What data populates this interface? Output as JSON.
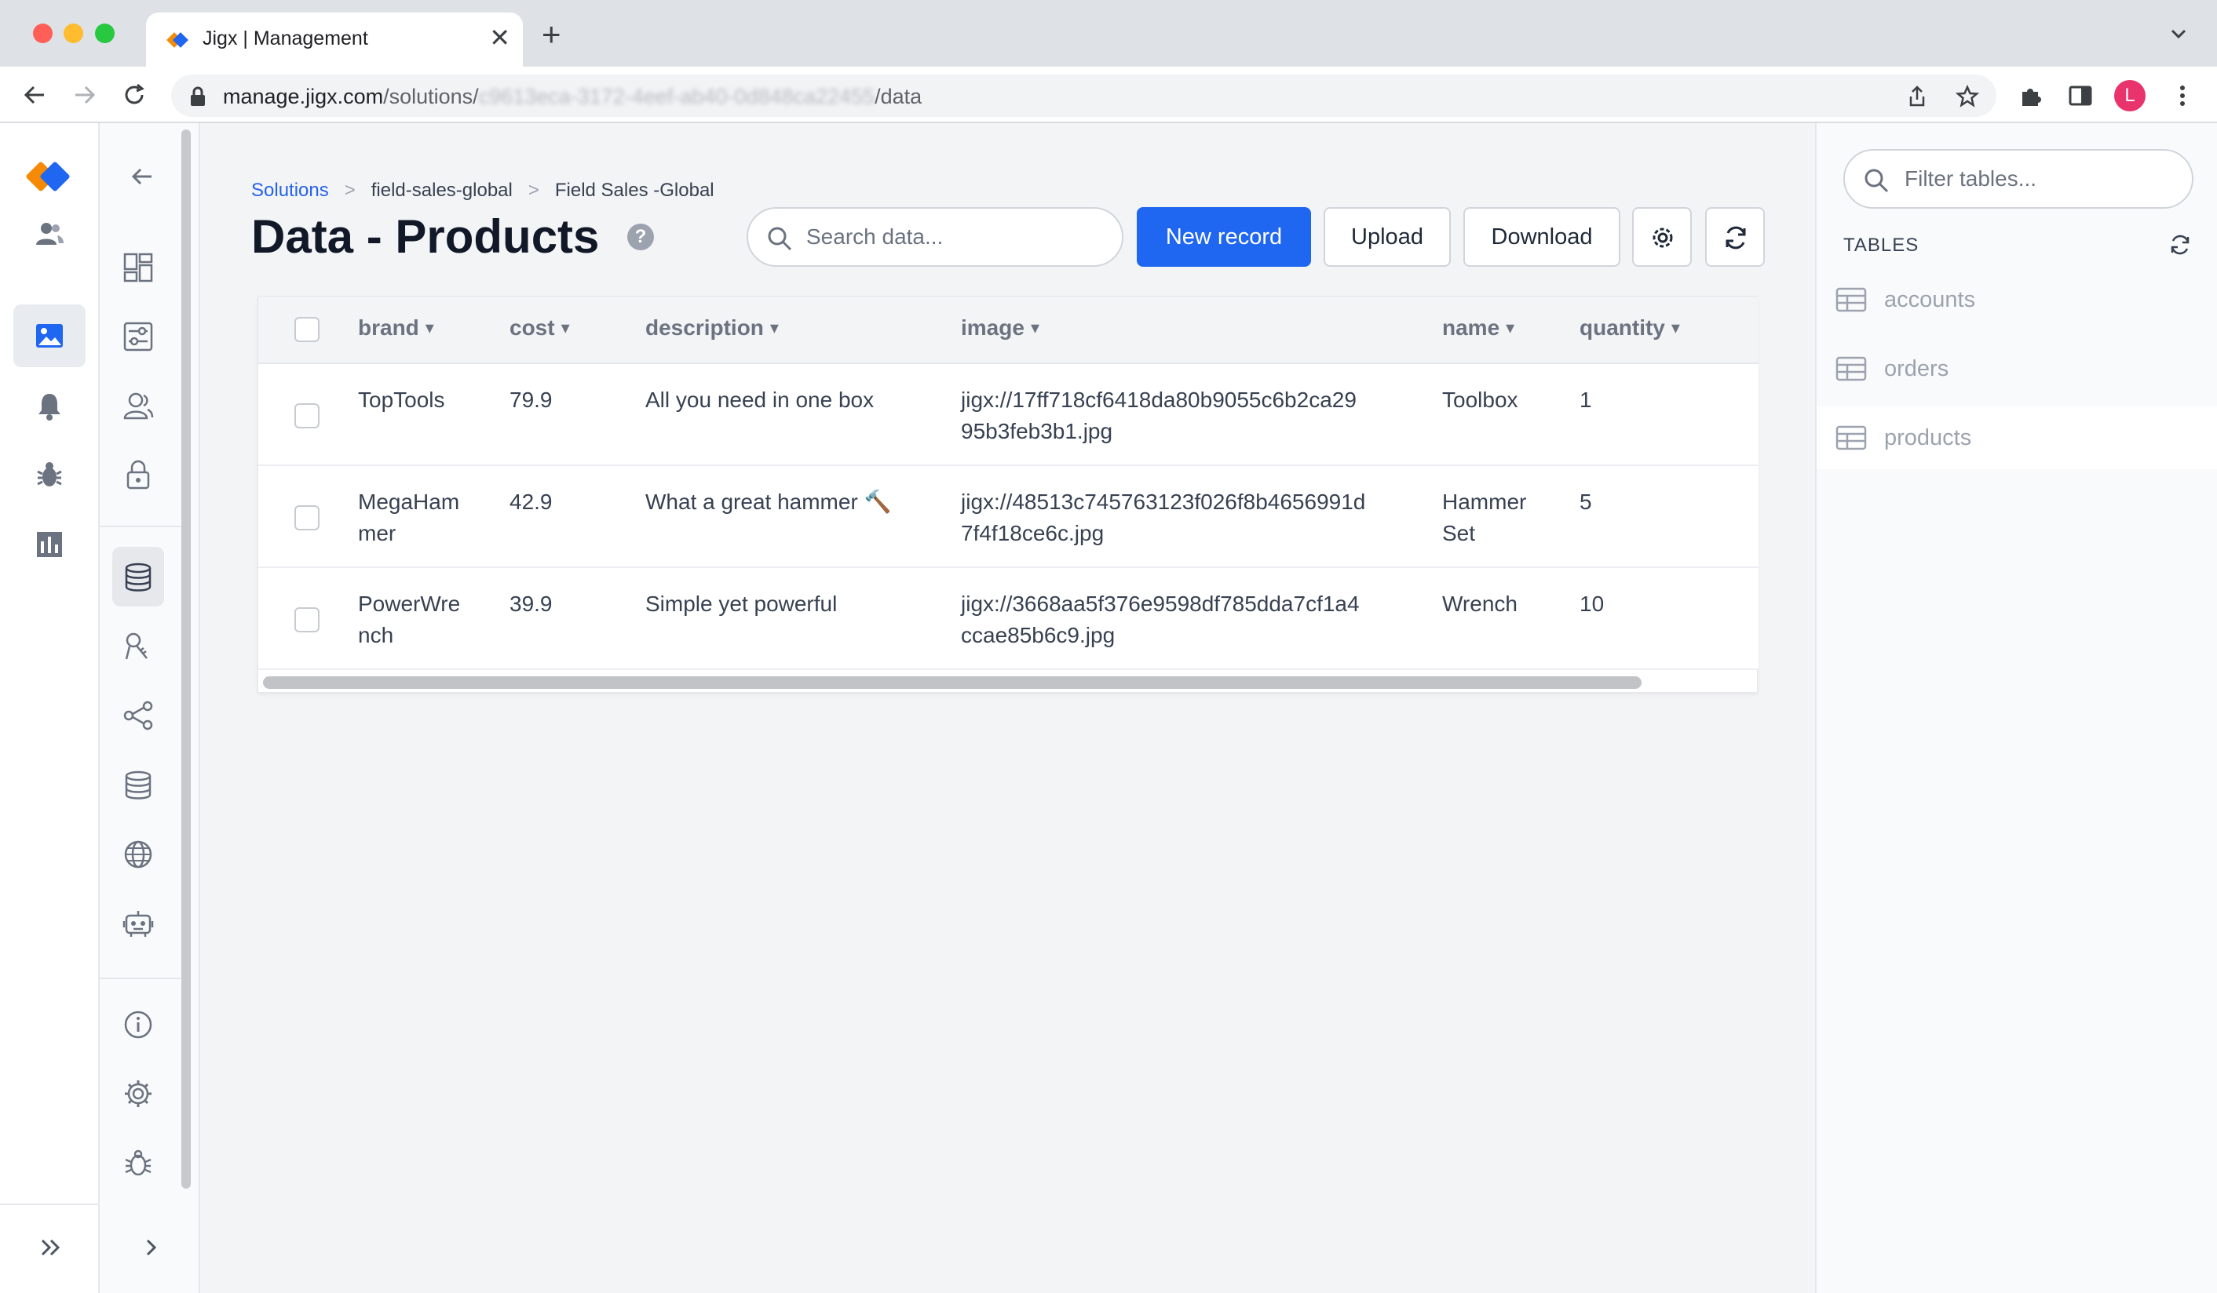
{
  "browser": {
    "tab_title": "Jigx | Management",
    "url_host": "manage.jigx.com",
    "url_path_1": "/solutions/",
    "url_blurred": "c9613eca-3172-4eef-ab40-0d848ca22455",
    "url_path_2": "/data",
    "profile_initial": "L"
  },
  "breadcrumb": {
    "items": [
      "Solutions",
      "field-sales-global",
      "Field Sales -Global"
    ],
    "separator": ">"
  },
  "page": {
    "title": "Data - Products",
    "help_glyph": "?"
  },
  "search": {
    "placeholder": "Search data..."
  },
  "actions": {
    "new_record": "New record",
    "upload": "Upload",
    "download": "Download"
  },
  "table": {
    "columns": [
      "brand",
      "cost",
      "description",
      "image",
      "name",
      "quantity"
    ],
    "rows": [
      {
        "brand": [
          "TopTools"
        ],
        "cost": "79.9",
        "description": "All you need in one box",
        "image": [
          "jigx://17ff718cf6418da80b9055c6b2ca29",
          "95b3feb3b1.jpg"
        ],
        "name": [
          "Toolbox"
        ],
        "quantity": "1"
      },
      {
        "brand": [
          "MegaHam",
          "mer"
        ],
        "cost": "42.9",
        "description": "What a great hammer 🔨",
        "image": [
          "jigx://48513c745763123f026f8b4656991d",
          "7f4f18ce6c.jpg"
        ],
        "name": [
          "Hammer",
          "Set"
        ],
        "quantity": "5"
      },
      {
        "brand": [
          "PowerWre",
          "nch"
        ],
        "cost": "39.9",
        "description": "Simple yet powerful",
        "image": [
          "jigx://3668aa5f376e9598df785dda7cf1a4",
          "ccae85b6c9.jpg"
        ],
        "name": [
          "Wrench"
        ],
        "quantity": "10"
      }
    ]
  },
  "tables_panel": {
    "filter_placeholder": "Filter tables...",
    "heading": "TABLES",
    "items": [
      "accounts",
      "orders",
      "products"
    ],
    "active": "products"
  },
  "colors": {
    "primary": "#1f66f0",
    "logo_orange": "#f58a07",
    "logo_blue": "#1f66f0",
    "profile": "#e8336d"
  }
}
